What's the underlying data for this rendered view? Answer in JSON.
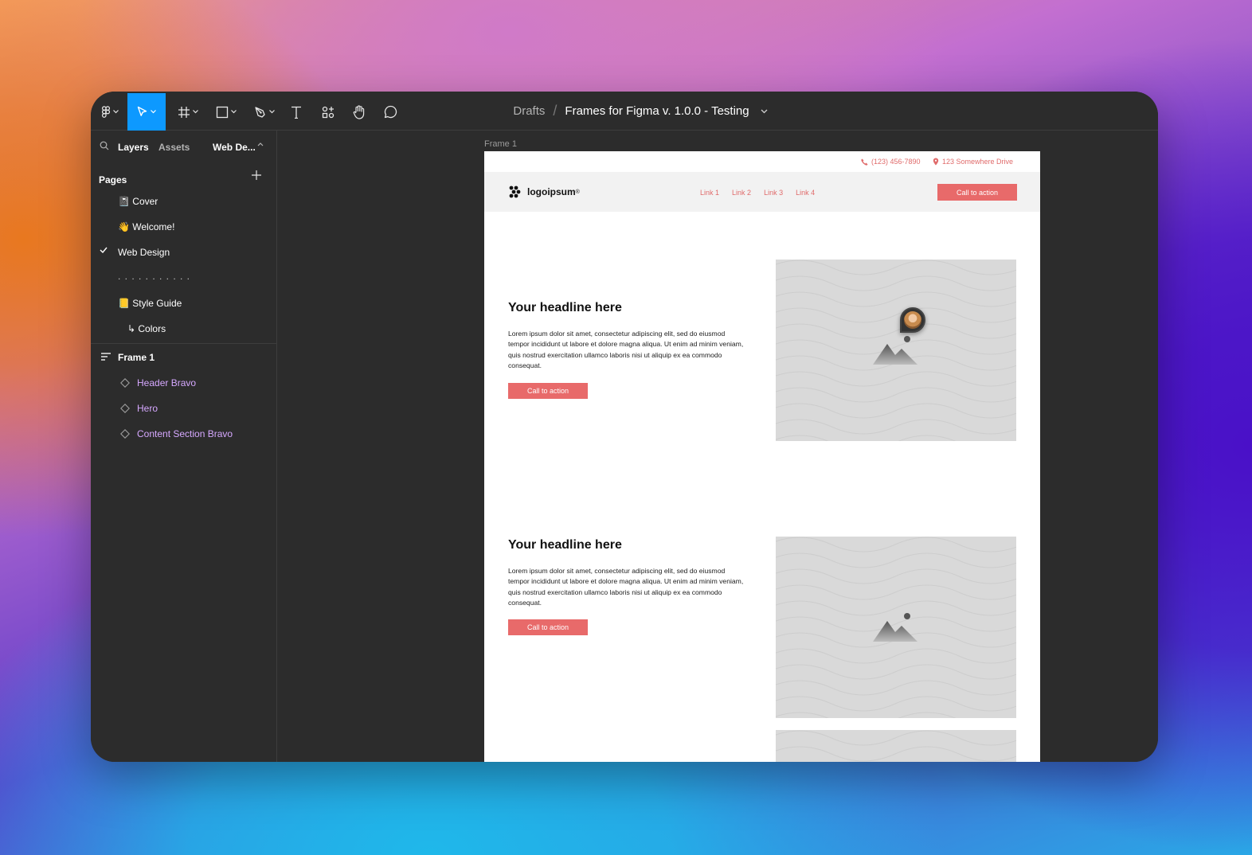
{
  "toolbar": {
    "breadcrumb_drafts": "Drafts",
    "breadcrumb_separator": "/",
    "file_name": "Frames for Figma v. 1.0.0 - Testing",
    "active_tool": "move",
    "accent_color": "#0d99ff"
  },
  "sidebar": {
    "tabs": {
      "layers": "Layers",
      "assets": "Assets",
      "page_switcher": "Web De..."
    },
    "pages_title": "Pages",
    "pages": [
      {
        "label": "📓 Cover",
        "selected": false
      },
      {
        "label": "👋 Welcome!",
        "selected": false
      },
      {
        "label": "Web Design",
        "selected": true
      },
      {
        "label": ". . . . . . . . . . .",
        "selected": false
      },
      {
        "label": "📒 Style Guide",
        "selected": false
      },
      {
        "label": "↳ Colors",
        "selected": false
      }
    ],
    "layers": {
      "frame": "Frame 1",
      "children": [
        "Header Bravo",
        "Hero",
        "Content Section Bravo"
      ]
    }
  },
  "canvas": {
    "frame_label": "Frame 1",
    "design": {
      "phone": "(123) 456-7890",
      "address": "123 Somewhere Drive",
      "logo": "logoipsum",
      "logo_mark": "®",
      "nav_links": [
        "Link 1",
        "Link 2",
        "Link 3",
        "Link 4"
      ],
      "nav_cta": "Call to action",
      "accent_color": "#e86a6a",
      "sections": [
        {
          "headline": "Your headline here",
          "body": "Lorem ipsum dolor sit amet, consectetur adipiscing elit, sed do eiusmod tempor incididunt ut labore et dolore magna aliqua. Ut enim ad minim veniam, quis nostrud exercitation ullamco laboris nisi ut aliquip ex ea commodo consequat.",
          "cta": "Call to action"
        },
        {
          "headline": "Your headline here",
          "body": "Lorem ipsum dolor sit amet, consectetur adipiscing elit, sed do eiusmod tempor incididunt ut labore et dolore magna aliqua. Ut enim ad minim veniam, quis nostrud exercitation ullamco laboris nisi ut aliquip ex ea commodo consequat.",
          "cta": "Call to action"
        }
      ]
    }
  }
}
